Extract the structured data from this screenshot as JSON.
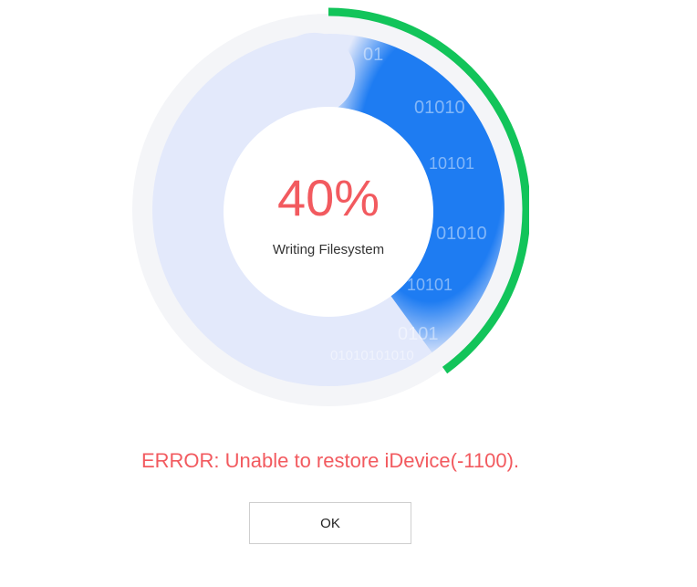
{
  "progress": {
    "percent_label": "40%",
    "value": 0.4,
    "status": "Writing Filesystem",
    "binary_pattern": [
      "01",
      "01010",
      "10101",
      "01010",
      "10101",
      "0101",
      "01010101010"
    ],
    "colors": {
      "ring_track": "#f4f5f8",
      "inner_disc": "#e3e9fb",
      "fill": "#1e7cf2",
      "progress_arc": "#12c45a",
      "text_accent": "#f25a5f"
    }
  },
  "error": {
    "message": "ERROR: Unable to restore iDevice(-1100)."
  },
  "dialog": {
    "ok_label": "OK"
  }
}
